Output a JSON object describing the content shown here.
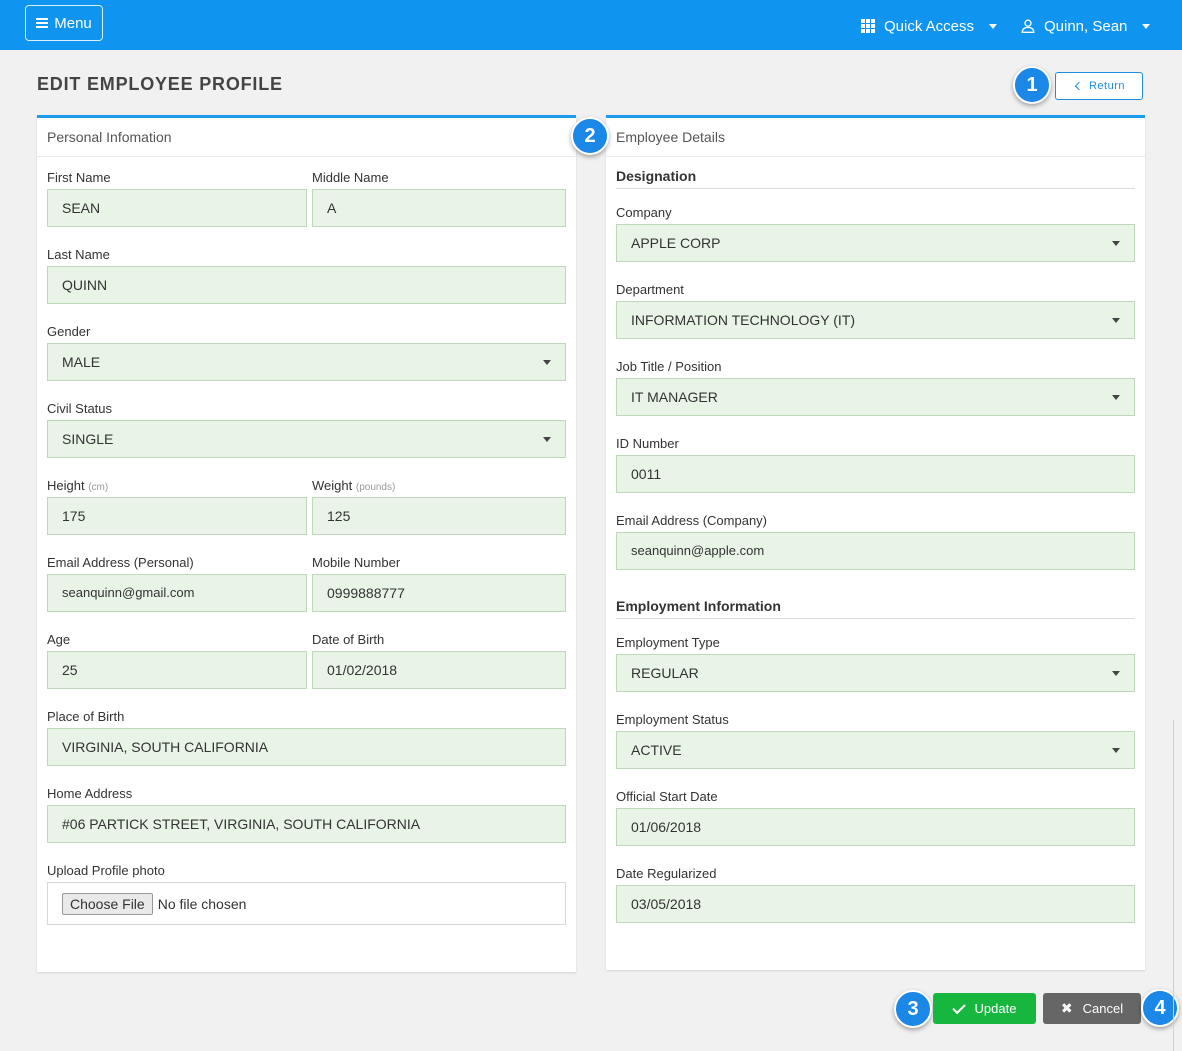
{
  "topbar": {
    "menu_label": "Menu",
    "quick_access": "Quick Access",
    "user_name": "Quinn, Sean"
  },
  "page": {
    "title": "EDIT EMPLOYEE PROFILE",
    "return_label": "Return"
  },
  "badges": [
    "1",
    "2",
    "3",
    "4"
  ],
  "personal": {
    "heading": "Personal Infomation",
    "first_name_label": "First Name",
    "first_name": "SEAN",
    "middle_name_label": "Middle Name",
    "middle_name": "A",
    "last_name_label": "Last Name",
    "last_name": "QUINN",
    "gender_label": "Gender",
    "gender": "MALE",
    "civil_label": "Civil Status",
    "civil": "SINGLE",
    "height_label": "Height",
    "height_unit": "(cm)",
    "height": "175",
    "weight_label": "Weight",
    "weight_unit": "(pounds)",
    "weight": "125",
    "email_label": "Email Address (Personal)",
    "email": "seanquinn@gmail.com",
    "mobile_label": "Mobile Number",
    "mobile": "0999888777",
    "age_label": "Age",
    "age": "25",
    "dob_label": "Date of Birth",
    "dob": "01/02/2018",
    "pob_label": "Place of Birth",
    "pob": "VIRGINIA, SOUTH CALIFORNIA",
    "address_label": "Home Address",
    "address": "#06 PARTICK STREET, VIRGINIA, SOUTH CALIFORNIA",
    "upload_label": "Upload Profile photo",
    "choose_file": "Choose File",
    "no_file": "No file chosen"
  },
  "employee": {
    "heading": "Employee Details",
    "designation_title": "Designation",
    "company_label": "Company",
    "company": "APPLE CORP",
    "department_label": "Department",
    "department": "INFORMATION TECHNOLOGY (IT)",
    "job_label": "Job Title / Position",
    "job": "IT MANAGER",
    "id_label": "ID Number",
    "id": "0011",
    "cemail_label": "Email Address (Company)",
    "cemail": "seanquinn@apple.com",
    "employment_title": "Employment Information",
    "type_label": "Employment Type",
    "type": "REGULAR",
    "status_label": "Employment Status",
    "status": "ACTIVE",
    "start_label": "Official Start Date",
    "start": "01/06/2018",
    "reg_label": "Date Regularized",
    "reg": "03/05/2018"
  },
  "actions": {
    "update": "Update",
    "cancel": "Cancel"
  },
  "colors": {
    "topbar": "#0f94f0",
    "accent": "#1d9ced",
    "field_bg": "#e8f4e6",
    "update": "#17b73f",
    "cancel": "#666666"
  }
}
